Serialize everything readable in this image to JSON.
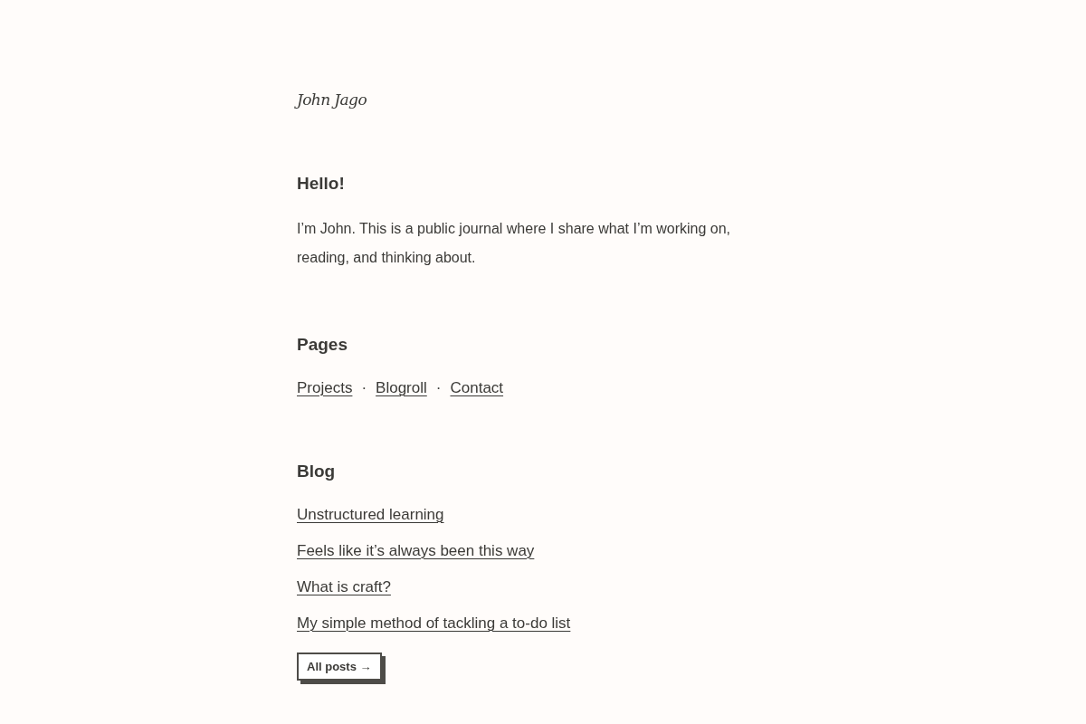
{
  "site_title": "John Jago",
  "intro": {
    "heading": "Hello!",
    "text": "I’m John. This is a public journal where I share what I’m working on, reading, and thinking about."
  },
  "pages": {
    "heading": "Pages",
    "items": [
      {
        "kind": "link",
        "text": "Projects"
      },
      {
        "kind": "separator",
        "text": "·"
      },
      {
        "kind": "link",
        "text": "Blogroll"
      },
      {
        "kind": "separator",
        "text": "·"
      },
      {
        "kind": "link",
        "text": "Contact"
      }
    ]
  },
  "blog": {
    "heading": "Blog",
    "posts": [
      "Unstructured learning",
      "Feels like it’s always been this way",
      "What is craft?",
      "My simple method of tackling a to-do list"
    ],
    "button": "All posts →"
  }
}
